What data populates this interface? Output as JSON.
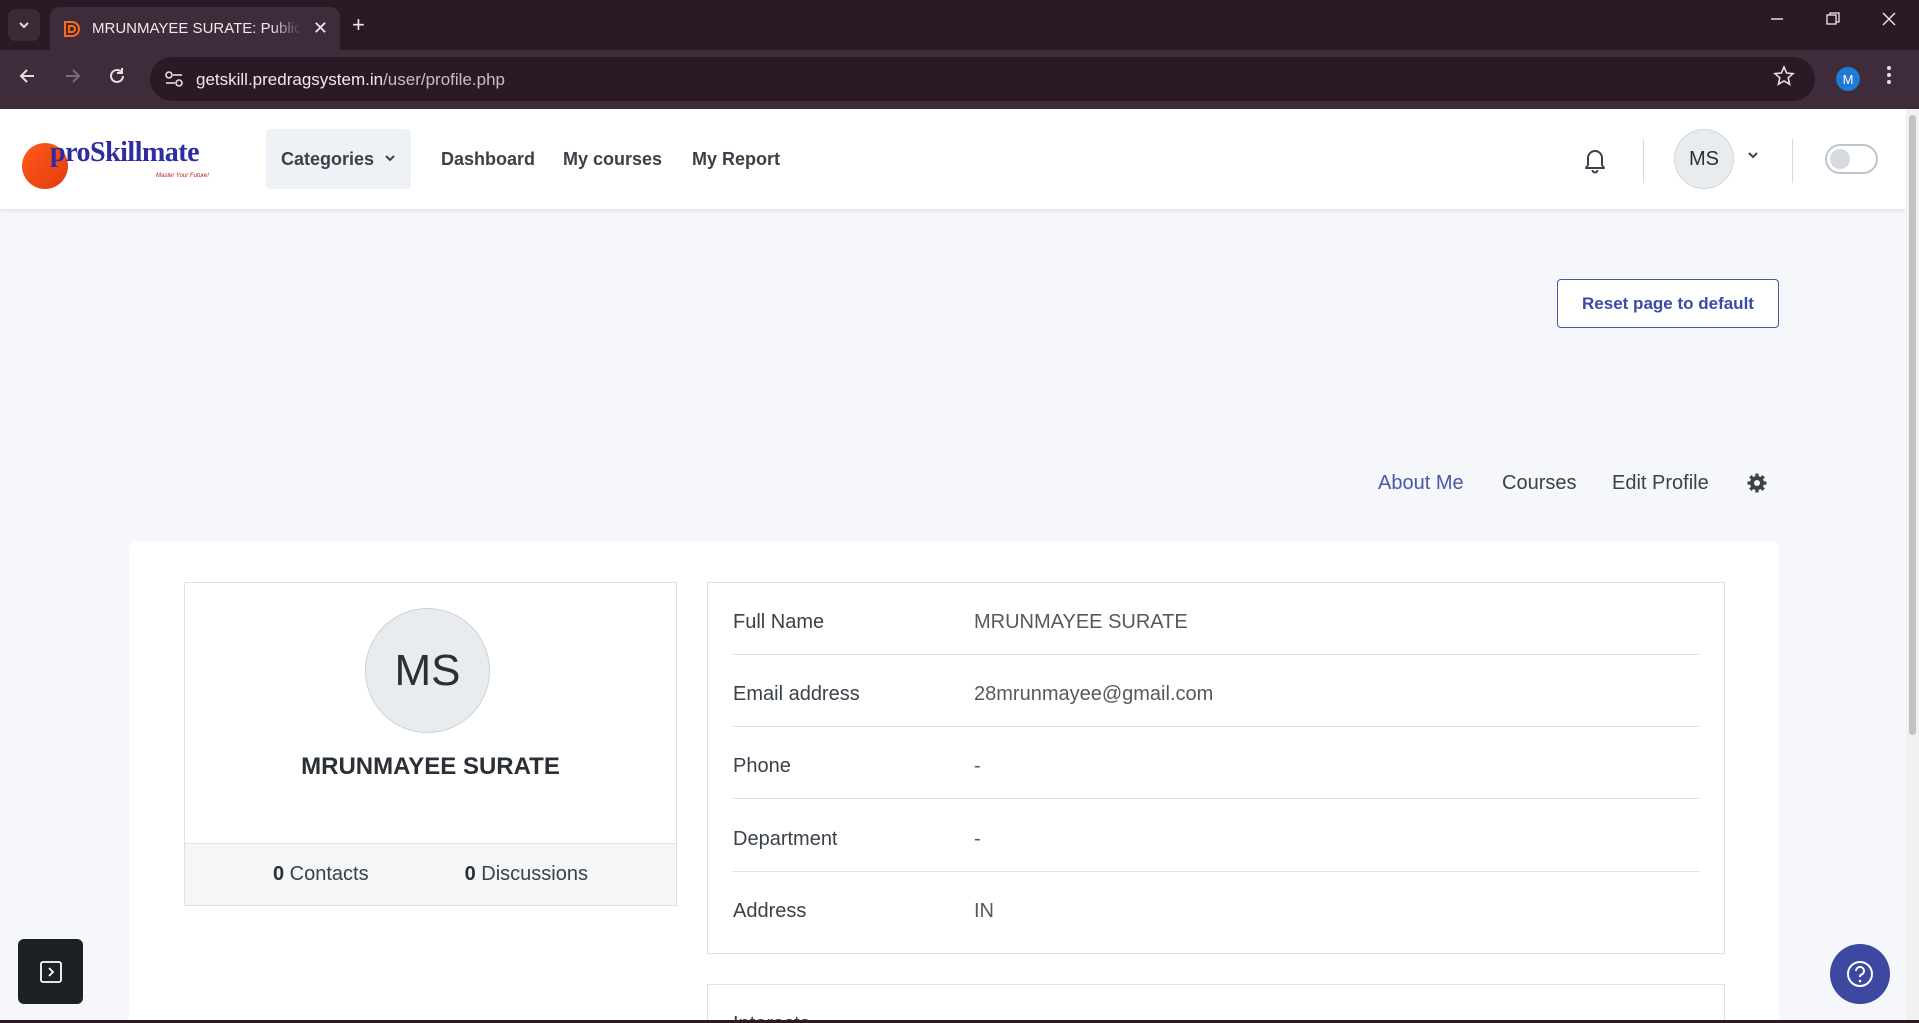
{
  "browser": {
    "tab_title": "MRUNMAYEE SURATE: Public profile",
    "tab_close": "✕",
    "new_tab": "+",
    "url_host": "getskill.predragsystem.in",
    "url_path": "/user/profile.php",
    "profile_initial": "M"
  },
  "header": {
    "logo_text": "proSkillmate",
    "logo_tagline": "Master Your Future!",
    "categories_label": "Categories",
    "nav": [
      "Dashboard",
      "My courses",
      "My Report"
    ],
    "avatar_initials": "MS"
  },
  "page": {
    "reset_label": "Reset page to default",
    "tabs": [
      "About Me",
      "Courses",
      "Edit Profile"
    ],
    "active_tab": "About Me"
  },
  "user": {
    "initials": "MS",
    "name": "MRUNMAYEE SURATE",
    "contacts_count": "0",
    "contacts_label": "Contacts",
    "discussions_count": "0",
    "discussions_label": "Discussions"
  },
  "details": [
    {
      "label": "Full Name",
      "value": "MRUNMAYEE SURATE"
    },
    {
      "label": "Email address",
      "value": "28mrunmayee@gmail.com"
    },
    {
      "label": "Phone",
      "value": "-"
    },
    {
      "label": "Department",
      "value": "-"
    },
    {
      "label": "Address",
      "value": "IN"
    }
  ],
  "details2_label": "Interests",
  "colors": {
    "accent": "#4a56a6",
    "help_button": "#3d48a0",
    "browser_frame": "#2b1a26"
  }
}
